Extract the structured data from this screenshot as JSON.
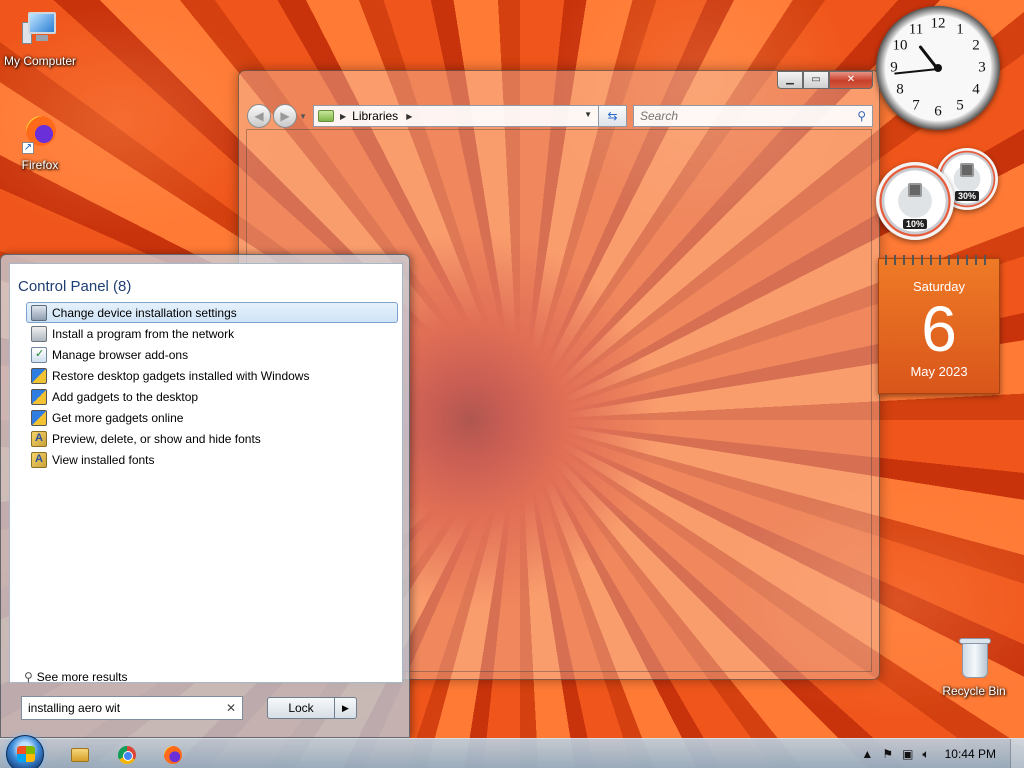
{
  "desktop": {
    "icons": [
      {
        "label": "My Computer",
        "icon": "my-computer-icon"
      },
      {
        "label": "Firefox",
        "icon": "firefox-icon"
      },
      {
        "label": "Recycle Bin",
        "icon": "recycle-bin-icon"
      }
    ]
  },
  "explorer": {
    "address_path": "Libraries",
    "search_placeholder": "Search",
    "caption_buttons": {
      "minimize": "▁",
      "maximize": "▭",
      "close": "✕"
    }
  },
  "gadgets": {
    "clock": {
      "numerals": [
        "12",
        "1",
        "2",
        "3",
        "4",
        "5",
        "6",
        "7",
        "8",
        "9",
        "10",
        "11"
      ],
      "hour": 10,
      "minute": 44
    },
    "cpu_meter": {
      "cpu_value": "10%",
      "memory_value": "30%"
    },
    "calendar": {
      "weekday": "Saturday",
      "day": "6",
      "month_year": "May 2023"
    }
  },
  "start_menu": {
    "section_title": "Control Panel (8)",
    "results": [
      {
        "label": "Change device installation settings",
        "icon": "device-settings-icon",
        "selected": true
      },
      {
        "label": "Install a program from the network",
        "icon": "network-install-icon",
        "selected": false
      },
      {
        "label": "Manage browser add-ons",
        "icon": "browser-addons-icon",
        "selected": false
      },
      {
        "label": "Restore desktop gadgets installed with Windows",
        "icon": "gadgets-icon",
        "selected": false
      },
      {
        "label": "Add gadgets to the desktop",
        "icon": "gadgets-icon",
        "selected": false
      },
      {
        "label": "Get more gadgets online",
        "icon": "gadgets-icon",
        "selected": false
      },
      {
        "label": "Preview, delete, or show and hide fonts",
        "icon": "fonts-icon",
        "selected": false
      },
      {
        "label": "View installed fonts",
        "icon": "fonts-icon",
        "selected": false
      }
    ],
    "see_more": "See more results",
    "search_value": "installing aero wit",
    "clear_glyph": "✕",
    "power_button": "Lock",
    "power_arrow": "▶"
  },
  "taskbar": {
    "pinned": [
      "windows-explorer-icon",
      "chrome-icon",
      "firefox-icon"
    ],
    "tray": {
      "show_hidden": "▲",
      "time": "10:44 PM"
    }
  }
}
